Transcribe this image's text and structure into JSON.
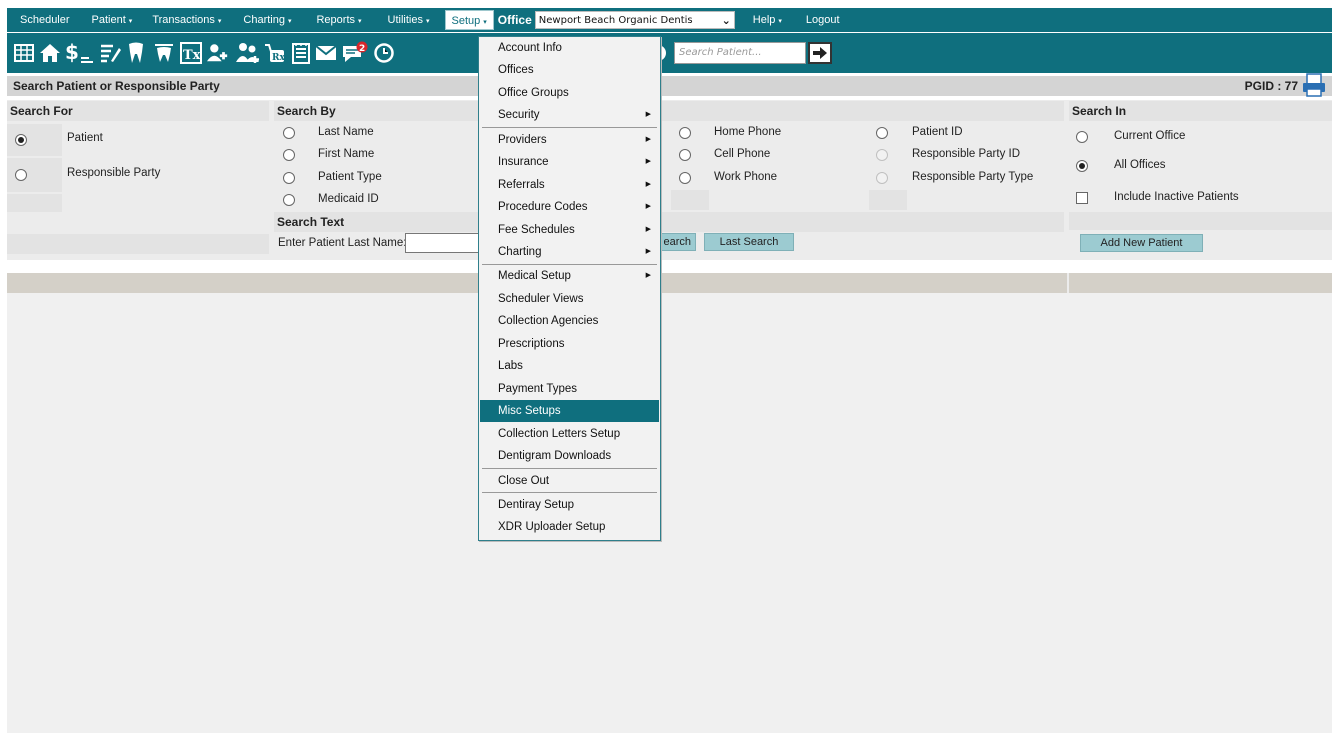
{
  "menubar": {
    "items": [
      {
        "label": "Scheduler",
        "caret": ""
      },
      {
        "label": "Patient",
        "caret": "▾"
      },
      {
        "label": "Transactions",
        "caret": "▾"
      },
      {
        "label": "Charting",
        "caret": "▾"
      },
      {
        "label": "Reports",
        "caret": "▾"
      },
      {
        "label": "Utilities",
        "caret": "▾"
      },
      {
        "label": "Setup",
        "caret": "▾"
      }
    ],
    "office_label": "Office",
    "office_value": "Newport Beach Organic Dentis",
    "help_label": "Help",
    "help_caret": "▾",
    "logout_label": "Logout"
  },
  "toolbar": {
    "search_placeholder": "Search Patient...",
    "badge_count": "2",
    "icons": [
      "calendar-grid-icon",
      "home-icon",
      "dollar-icon",
      "notes-icon",
      "tooth-icon",
      "tooth-chart-icon",
      "treatment-icon",
      "add-patient-icon",
      "family-icon",
      "prescription-icon",
      "ledger-icon",
      "mail-icon",
      "messages-icon",
      "clock-icon"
    ]
  },
  "panel": {
    "title": "Search Patient or Responsible Party",
    "pgid": "PGID : 77"
  },
  "search_for": {
    "heading": "Search For",
    "options": [
      "Patient",
      "Responsible Party"
    ],
    "selected": "Patient"
  },
  "search_by": {
    "heading": "Search By",
    "col1": [
      "Last Name",
      "First Name",
      "Patient Type",
      "Medicaid ID"
    ],
    "col2": [
      "Home Phone",
      "Cell Phone",
      "Work Phone"
    ],
    "col3": [
      "Patient ID",
      "Responsible Party ID",
      "Responsible Party Type"
    ]
  },
  "search_text": {
    "heading": "Search Text",
    "label": "Enter Patient Last Name:",
    "value": "",
    "search_button": "earch",
    "last_search_button": "Last Search"
  },
  "search_in": {
    "heading": "Search In",
    "options": [
      "Current Office",
      "All Offices"
    ],
    "selected": "All Offices",
    "include_inactive": "Include Inactive Patients",
    "add_button": "Add New Patient"
  },
  "setup_menu": {
    "items": [
      {
        "label": "Account Info",
        "sub": false
      },
      {
        "label": "Offices",
        "sub": false
      },
      {
        "label": "Office Groups",
        "sub": false
      },
      {
        "label": "Security",
        "sub": true
      },
      {
        "label": "Providers",
        "sub": true
      },
      {
        "label": "Insurance",
        "sub": true
      },
      {
        "label": "Referrals",
        "sub": true
      },
      {
        "label": "Procedure Codes",
        "sub": true
      },
      {
        "label": "Fee Schedules",
        "sub": true
      },
      {
        "label": "Charting",
        "sub": true
      },
      {
        "label": "Medical Setup",
        "sub": true
      },
      {
        "label": "Scheduler Views",
        "sub": false
      },
      {
        "label": "Collection Agencies",
        "sub": false
      },
      {
        "label": "Prescriptions",
        "sub": false
      },
      {
        "label": "Labs",
        "sub": false
      },
      {
        "label": "Payment Types",
        "sub": false
      },
      {
        "label": "Misc Setups",
        "sub": false
      },
      {
        "label": "Collection Letters Setup",
        "sub": false
      },
      {
        "label": "Dentigram Downloads",
        "sub": false
      },
      {
        "label": "Close Out",
        "sub": false
      },
      {
        "label": "Dentiray Setup",
        "sub": false
      },
      {
        "label": "XDR Uploader Setup",
        "sub": false
      }
    ],
    "highlighted": "Misc Setups",
    "submenu_arrow": "▶"
  },
  "colors": {
    "brand": "#0f6f7e",
    "button": "#9ccbd1",
    "header_gray": "#d4d4d4"
  }
}
